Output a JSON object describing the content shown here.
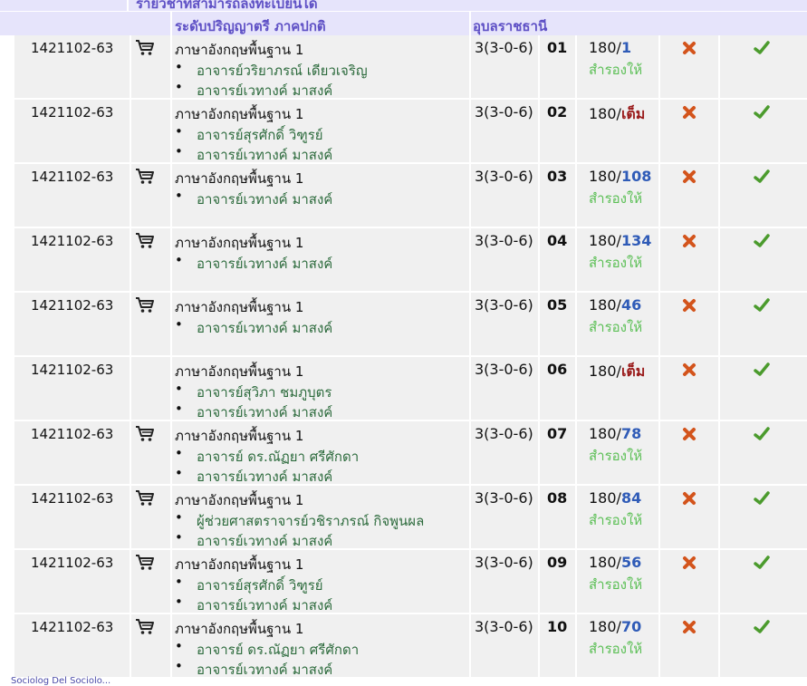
{
  "header": {
    "top_title": "รายวิชาที่สามารถลงทะเบียนได้",
    "program": "ระดับปริญญาตรี ภาคปกติ",
    "campus": "อุบลราชธานี"
  },
  "rows": [
    {
      "code": "1421102-63",
      "cart": true,
      "title": "ภาษาอังกฤษพื้นฐาน 1",
      "instructors": [
        "อาจารย์วริยาภรณ์ เดียวเจริญ",
        "อาจารย์เวทางค์ มาสงค์"
      ],
      "credit": "3(3-0-6)",
      "section": "01",
      "capacity": "180/",
      "remaining": "1",
      "reserve": "สำรองให้"
    },
    {
      "code": "1421102-63",
      "cart": false,
      "title": "ภาษาอังกฤษพื้นฐาน 1",
      "instructors": [
        "อาจารย์สุรศักดิ์ วิฑูรย์",
        "อาจารย์เวทางค์ มาสงค์"
      ],
      "credit": "3(3-0-6)",
      "section": "02",
      "capacity": "180/",
      "remaining": "เต็ม",
      "reserve": ""
    },
    {
      "code": "1421102-63",
      "cart": true,
      "title": "ภาษาอังกฤษพื้นฐาน 1",
      "instructors": [
        "อาจารย์เวทางค์ มาสงค์"
      ],
      "credit": "3(3-0-6)",
      "section": "03",
      "capacity": "180/",
      "remaining": "108",
      "reserve": "สำรองให้"
    },
    {
      "code": "1421102-63",
      "cart": true,
      "title": "ภาษาอังกฤษพื้นฐาน 1",
      "instructors": [
        "อาจารย์เวทางค์ มาสงค์"
      ],
      "credit": "3(3-0-6)",
      "section": "04",
      "capacity": "180/",
      "remaining": "134",
      "reserve": "สำรองให้"
    },
    {
      "code": "1421102-63",
      "cart": true,
      "title": "ภาษาอังกฤษพื้นฐาน 1",
      "instructors": [
        "อาจารย์เวทางค์ มาสงค์"
      ],
      "credit": "3(3-0-6)",
      "section": "05",
      "capacity": "180/",
      "remaining": "46",
      "reserve": "สำรองให้"
    },
    {
      "code": "1421102-63",
      "cart": false,
      "title": "ภาษาอังกฤษพื้นฐาน 1",
      "instructors": [
        "อาจารย์สุวิภา ชมภูบุตร",
        "อาจารย์เวทางค์ มาสงค์"
      ],
      "credit": "3(3-0-6)",
      "section": "06",
      "capacity": "180/",
      "remaining": "เต็ม",
      "reserve": ""
    },
    {
      "code": "1421102-63",
      "cart": true,
      "title": "ภาษาอังกฤษพื้นฐาน 1",
      "instructors": [
        "อาจารย์ ดร.ณัฏยา ศรีศักดา",
        "อาจารย์เวทางค์ มาสงค์"
      ],
      "credit": "3(3-0-6)",
      "section": "07",
      "capacity": "180/",
      "remaining": "78",
      "reserve": "สำรองให้"
    },
    {
      "code": "1421102-63",
      "cart": true,
      "title": "ภาษาอังกฤษพื้นฐาน 1",
      "instructors": [
        "ผู้ช่วยศาสตราจารย์วชิราภรณ์ กิจพูนผล",
        "อาจารย์เวทางค์ มาสงค์"
      ],
      "credit": "3(3-0-6)",
      "section": "08",
      "capacity": "180/",
      "remaining": "84",
      "reserve": "สำรองให้"
    },
    {
      "code": "1421102-63",
      "cart": true,
      "title": "ภาษาอังกฤษพื้นฐาน 1",
      "instructors": [
        "อาจารย์สุรศักดิ์ วิฑูรย์",
        "อาจารย์เวทางค์ มาสงค์"
      ],
      "credit": "3(3-0-6)",
      "section": "09",
      "capacity": "180/",
      "remaining": "56",
      "reserve": "สำรองให้"
    },
    {
      "code": "1421102-63",
      "cart": true,
      "title": "ภาษาอังกฤษพื้นฐาน 1",
      "instructors": [
        "อาจารย์ ดร.ณัฏยา ศรีศักดา",
        "อาจารย์เวทางค์ มาสงค์"
      ],
      "credit": "3(3-0-6)",
      "section": "10",
      "capacity": "180/",
      "remaining": "70",
      "reserve": "สำรองให้"
    }
  ],
  "footer": {
    "link": "Sociolog Del Sociolo..."
  },
  "colors": {
    "header_bg": "#e6e4fb",
    "header_text": "#5e50c5",
    "cell_bg": "#f0f0f0",
    "instructor": "#2d6b3d",
    "remaining": "#2f5bb7",
    "full": "#9a1b1b",
    "reserve": "#5bbf55"
  },
  "icons": {
    "cart": "shopping-cart-icon",
    "delete": "delete-x-icon",
    "confirm": "checkmark-icon"
  }
}
